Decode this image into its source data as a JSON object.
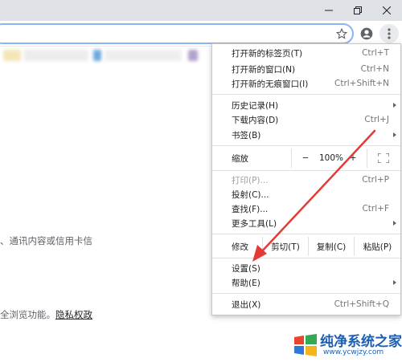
{
  "window": {
    "minimize_icon": "minimize-icon",
    "restore_icon": "restore-icon",
    "close_icon": "close-icon"
  },
  "toolbar": {
    "star_icon": "star-icon",
    "profile_icon": "profile-icon",
    "menu_icon": "three-dots-icon"
  },
  "page": {
    "line1": "、通讯内容或信用卡信",
    "line2_prefix": "全浏览功能。",
    "privacy_link": "隐私权政"
  },
  "menu": {
    "new_tab": {
      "label": "打开新的标签页(T)",
      "shortcut": "Ctrl+T"
    },
    "new_window": {
      "label": "打开新的窗口(N)",
      "shortcut": "Ctrl+N"
    },
    "incognito": {
      "label": "打开新的无痕窗口(I)",
      "shortcut": "Ctrl+Shift+N"
    },
    "history": {
      "label": "历史记录(H)"
    },
    "downloads": {
      "label": "下载内容(D)",
      "shortcut": "Ctrl+J"
    },
    "bookmarks": {
      "label": "书签(B)"
    },
    "zoom": {
      "label": "缩放",
      "minus": "−",
      "value": "100%",
      "plus": "+",
      "fullscreen_icon": "fullscreen-icon"
    },
    "print": {
      "label": "打印(P)...",
      "shortcut": "Ctrl+P"
    },
    "cast": {
      "label": "投射(C)..."
    },
    "find": {
      "label": "查找(F)...",
      "shortcut": "Ctrl+F"
    },
    "more_tools": {
      "label": "更多工具(L)"
    },
    "edit": {
      "label": "修改",
      "cut": "剪切(T)",
      "copy": "复制(C)",
      "paste": "粘贴(P)"
    },
    "settings": {
      "label": "设置(S)"
    },
    "help": {
      "label": "帮助(E)"
    },
    "exit": {
      "label": "退出(X)",
      "shortcut": "Ctrl+Shift+Q"
    }
  },
  "watermark": {
    "title": "纯净系统之家",
    "url": "www.ycwjzy.com"
  },
  "colors": {
    "annotation_arrow": "#e53935",
    "watermark_blue": "#1a5fb4"
  }
}
